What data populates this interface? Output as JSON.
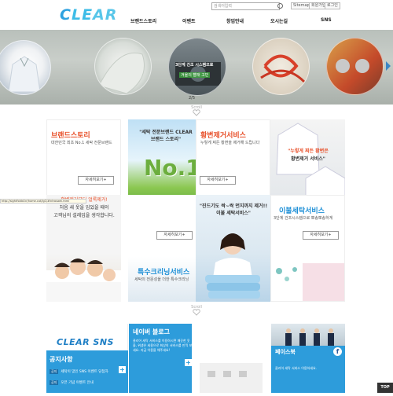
{
  "header": {
    "logo": "CLEAR",
    "search_placeholder": "검색어입력",
    "util_links": [
      "Sitemap",
      "회원가입",
      "로그인"
    ],
    "nav": [
      "브랜드스토리",
      "이벤트",
      "창업안내",
      "오시는길",
      "SNS"
    ]
  },
  "slider": {
    "counter": "2/5",
    "center_caption_1": "3단계 건조 시스템으로",
    "center_caption_2": "겨울의 빨래 고민",
    "scroll_label": "Scroll"
  },
  "grid": {
    "brand": {
      "title": "브랜드스토리",
      "desc": "대한민국 최초 No.1 세탁 전문브랜드",
      "button": "자세히보기+"
    },
    "brand_quote": {
      "line1": "\"세탁 전문브랜드 CLEAR",
      "line2": "브랜드 스토리\"",
      "big": "No.1"
    },
    "stain": {
      "title": "황변제거서비스",
      "desc": "누렇게 찌든 황변을 제거해 드립니다",
      "button": "자세히보기+"
    },
    "stain_quote": {
      "line1": "\"누렇게 찌든 황변은",
      "line2": "황변제거 서비스\""
    },
    "yellow_text": {
      "line1": "황변제거부터 얼룩제거!",
      "line2": "처음 새 옷을 입었을 때의",
      "line3": "고객님의 설레임을 생각합니다."
    },
    "special": {
      "title": "특수크리닝서비스",
      "desc": "세탁의 전문성을 더한 특수크리닝",
      "button": "자세히보기+"
    },
    "bedding_quote": {
      "line1": "\"진드기도 싹~싹 먼지까지 제거!!",
      "line2": "이불 세탁서비스\""
    },
    "bedding": {
      "title": "이불세탁서비스",
      "desc1": "3단계 건조시스템으로 뽀송뽀송하게",
      "button": "자세히보기+"
    }
  },
  "bottom": {
    "sns_title": "CLEAR SNS",
    "notice_title": "공지사항",
    "notice_rows": [
      {
        "badge": "공지",
        "text": "세탁이 맞인 SNS 이벤트 당첨자"
      },
      {
        "badge": "공지",
        "text": "오픈 기념 이벤트 안내"
      }
    ],
    "blog_title": "네이버 블로그",
    "blog_desc": "클리어 세탁 서비스를 이용하시면 깨끗한 옷을, 위생은 세용으로 최상의 서비스를 만끽 보세요. 지금 이용을 해주세요!",
    "fb_title": "페이스북",
    "fb_desc": "클리어 세탁 서비스 이용하세요."
  },
  "status_tooltip": "http://sightfoldd.kr/home.cot/ig1/#introsaeli.html",
  "top_button": "TOP",
  "colors": {
    "accent": "#2d9cdb",
    "brand_red": "#e8502a",
    "green": "#5aa63a"
  }
}
